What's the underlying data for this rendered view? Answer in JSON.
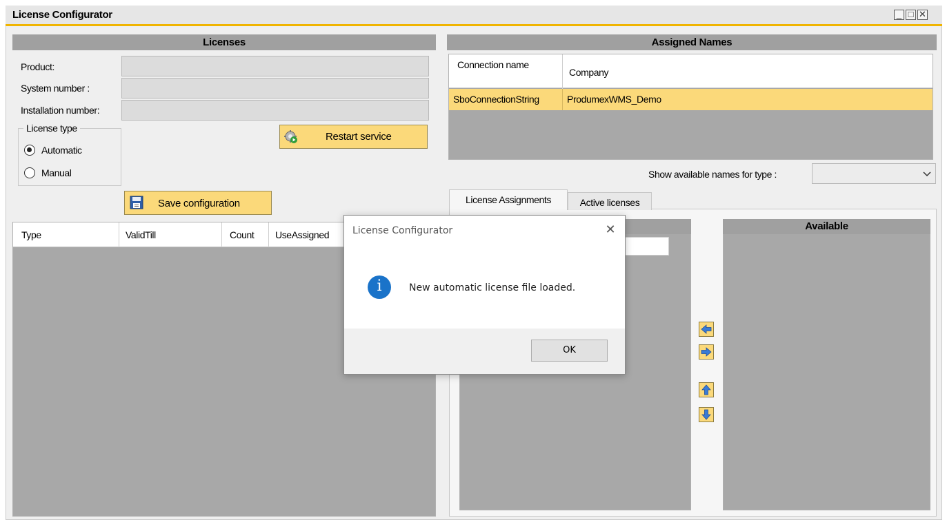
{
  "window": {
    "title": "License Configurator",
    "controls": {
      "minimize": "_",
      "maximize": "□",
      "close": "✕"
    }
  },
  "licenses": {
    "header": "Licenses",
    "product_label": "Product:",
    "product_value": "",
    "system_number_label": "System number :",
    "system_number_value": "",
    "installation_number_label": "Installation number:",
    "installation_number_value": "",
    "license_type": {
      "legend": "License type",
      "options": [
        {
          "label": "Automatic",
          "selected": true
        },
        {
          "label": "Manual",
          "selected": false
        }
      ]
    },
    "restart_button": "Restart service",
    "save_button": "Save configuration",
    "grid_columns": [
      "Type",
      "ValidTill",
      "Count",
      "UseAssigned"
    ]
  },
  "assigned_names": {
    "header": "Assigned Names",
    "columns": [
      "Connection name",
      "Company"
    ],
    "rows": [
      {
        "connection": "SboConnectionString",
        "company": "ProdumexWMS_Demo",
        "selected": true
      }
    ],
    "show_names_label": "Show available names for type :",
    "show_names_value": "",
    "tabs": [
      {
        "label": "License Assignments",
        "active": true
      },
      {
        "label": "Active licenses",
        "active": false
      }
    ],
    "available_header": "Available",
    "accent_color": "#fbd97a"
  },
  "dialog": {
    "title": "License Configurator",
    "close": "✕",
    "icon": "info-icon",
    "icon_glyph": "i",
    "message": "New automatic license file loaded.",
    "ok": "OK"
  }
}
